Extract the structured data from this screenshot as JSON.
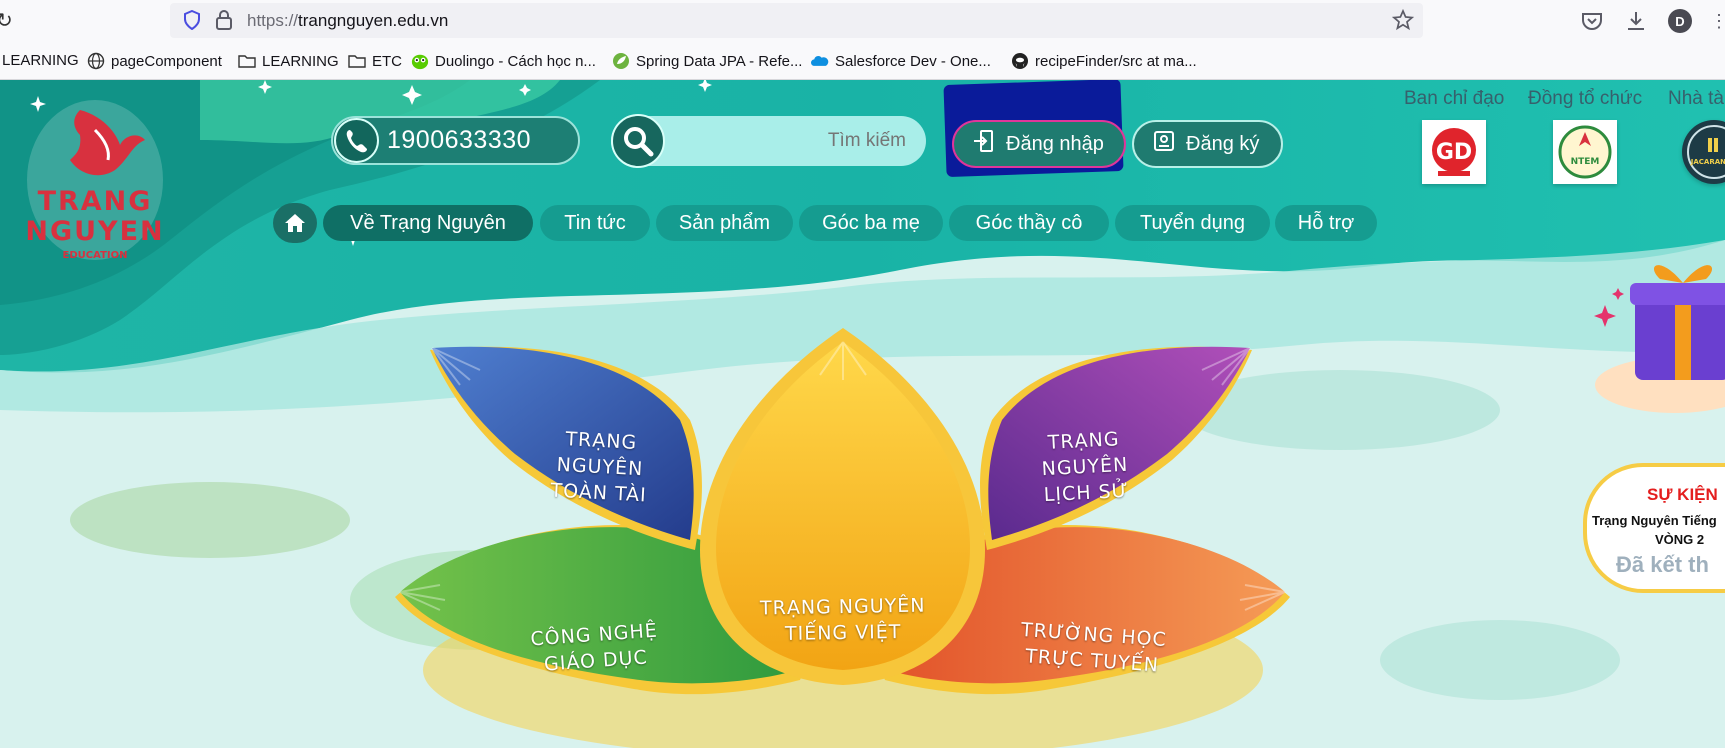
{
  "browser": {
    "url_protocol": "https://",
    "url_host": "trangnguyen.edu.vn",
    "profile_initial": "D",
    "bookmarks": [
      {
        "label": "LEARNING",
        "icon": "none"
      },
      {
        "label": "pageComponent",
        "icon": "globe-icon"
      },
      {
        "label": "LEARNING",
        "icon": "folder-icon"
      },
      {
        "label": "ETC",
        "icon": "folder-icon"
      },
      {
        "label": "Duolingo - Cách học n...",
        "icon": "duolingo-icon"
      },
      {
        "label": "Spring Data JPA - Refe...",
        "icon": "spring-icon"
      },
      {
        "label": "Salesforce Dev - One...",
        "icon": "salesforce-icon"
      },
      {
        "label": "recipeFinder/src at ma...",
        "icon": "github-icon"
      }
    ]
  },
  "header": {
    "phone": "1900633330",
    "search_placeholder": "Tìm kiếm",
    "login_label": "Đăng nhập",
    "register_label": "Đăng ký"
  },
  "sponsors": [
    {
      "label": "Ban chỉ đạo",
      "logo": "GD"
    },
    {
      "label": "Đồng tổ chức",
      "logo": "NTEM"
    },
    {
      "label": "Nhà tà",
      "logo": "JACARANDA"
    }
  ],
  "nav": {
    "items": [
      {
        "label": "Về Trạng Nguyên",
        "active": true
      },
      {
        "label": "Tin tức",
        "active": false
      },
      {
        "label": "Sản phẩm",
        "active": false
      },
      {
        "label": "Góc ba mẹ",
        "active": false
      },
      {
        "label": "Góc thầy cô",
        "active": false
      },
      {
        "label": "Tuyển dụng",
        "active": false
      },
      {
        "label": "Hỗ trợ",
        "active": false
      }
    ]
  },
  "lotus": {
    "top_left": [
      "TRẠNG",
      "NGUYÊN",
      "TOÀN TÀI"
    ],
    "center": [
      "TRẠNG NGUYÊN",
      "TIẾNG VIỆT"
    ],
    "top_right": [
      "TRẠNG",
      "NGUYÊN",
      "LỊCH SỬ"
    ],
    "bottom_left": [
      "CÔNG NGHỆ",
      "GIÁO DỤC"
    ],
    "bottom_right": [
      "TRƯỜNG HỌC",
      "TRỰC TUYẾN"
    ]
  },
  "event": {
    "title": "SỰ KIỆN",
    "subtitle": "Trạng Nguyên Tiếng",
    "round": "VÒNG 2",
    "status": "Đã kết th"
  },
  "colors": {
    "teal_dark": "#0f6f65",
    "teal_nav": "#159c90",
    "login_highlight": "#0a1b9a",
    "login_border": "#e0359a",
    "event_red": "#e41e1e"
  }
}
